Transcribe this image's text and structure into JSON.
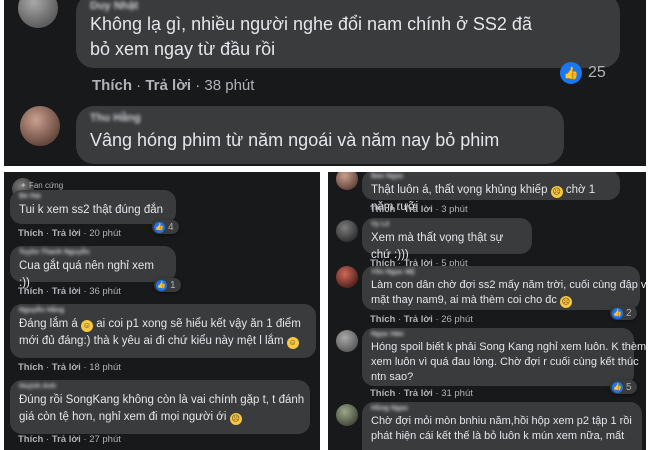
{
  "colors": {
    "panel_bg": "#18191a",
    "bubble_bg": "#3a3b3c",
    "text": "#e4e6eb",
    "muted": "#b0b3b8",
    "like_blue": "#1877f2"
  },
  "actions": {
    "like": "Thích",
    "reply": "Trả lời"
  },
  "top": {
    "comments": [
      {
        "name": "Duy Nhật",
        "text_lines": [
          "Không lạ gì, nhiều người nghe đổi nam chính ở SS2 đã",
          "bỏ xem ngay từ đầu rồi"
        ],
        "time": "38 phút",
        "likes": "25"
      },
      {
        "name": "Thu Hằng",
        "text_lines": [
          "Vâng hóng phim từ năm ngoái và năm nay bỏ phim"
        ]
      }
    ]
  },
  "left": {
    "fan_badge": "Fan cứng",
    "comments": [
      {
        "name": "Bé Hải",
        "text_lines": [
          "Tui k xem ss2 thật đúng đắn"
        ],
        "time": "20 phút",
        "likes": "4"
      },
      {
        "name": "Tuyền Thanh Nguyễn",
        "text_lines": [
          "Cua gắt quá nên nghỉ xem :))"
        ],
        "time": "36 phút",
        "likes": "1"
      },
      {
        "name": "Nguyễn Hằng",
        "text_lines": [
          "Đáng lắm á",
          "ai coi p1 xong sẽ hiểu kết vậy ăn 1 điểm",
          "mới đủ đáng:) thà k yêu ai đi chứ kiểu này mệt l lắm"
        ],
        "time": "18 phút",
        "emoji": "😀"
      },
      {
        "name": "Huỳnh Anh",
        "text_lines": [
          "Đúng rồi SongKang không còn là vai chính gặp t, t đánh",
          "giá còn tệ hơn, nghỉ xem đi mọi người ới"
        ],
        "time": "27 phút",
        "emoji": "😓"
      }
    ]
  },
  "right": {
    "comments": [
      {
        "name": "Bảo Ngọc",
        "text_lines": [
          "Thật luôn á, thất vọng khủng khiếp",
          "chờ 1 năm rưỡi"
        ],
        "time": "3 phút",
        "emoji": "😩"
      },
      {
        "name": "Vy Lê",
        "text_lines": [
          "Xem mà thất vọng thật sự chứ :)))"
        ],
        "time": "5 phút"
      },
      {
        "name": "Yến Ngọc Mỹ",
        "text_lines": [
          "Làm con dân chờ đợi ss2 mấy năm trời, cuối cùng đập vô",
          "mặt thay nam9, ai mà thèm coi cho đc"
        ],
        "time": "26 phút",
        "likes": "2",
        "emoji": "😩"
      },
      {
        "name": "Ngọc Hân",
        "text_lines": [
          "Hóng spoil biết k phải Song Kang nghỉ xem luôn. K thèm",
          "xem luôn vì quá đau lòng. Chờ đợi r cuối cùng kết thúc",
          "ntn sao?"
        ],
        "time": "31 phút",
        "likes": "5"
      },
      {
        "name": "Hồng Ngọc",
        "text_lines": [
          "Chờ đợi mỏi mòn bnhiu năm,hồi hộp xem p2 tập 1 rồi",
          "phát hiện cái kết thế là bỏ luôn k mún xem nữa, mất"
        ]
      }
    ]
  }
}
